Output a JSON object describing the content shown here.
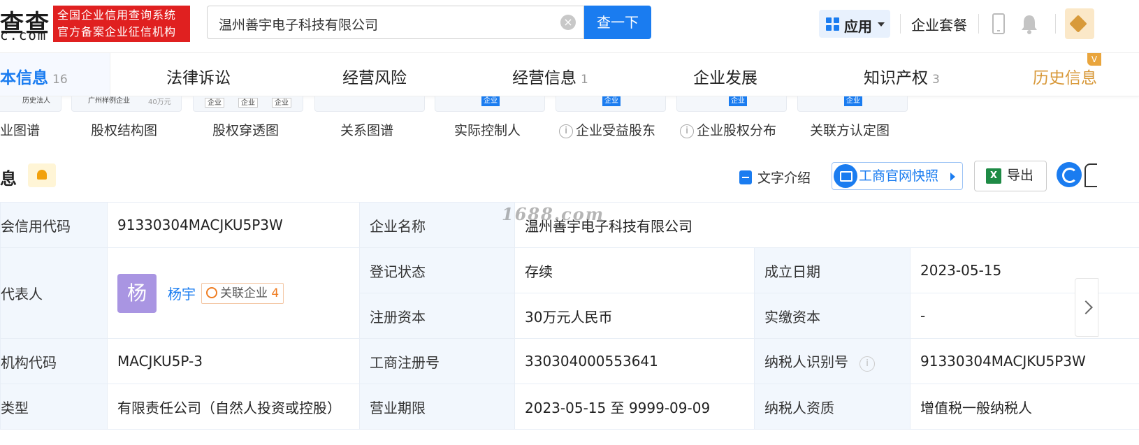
{
  "header": {
    "logo_text": "查查",
    "logo_sub": "c.com",
    "slogan_line1": "全国企业信用查询系统",
    "slogan_line2": "官方备案企业征信机构",
    "search_value": "温州善宇电子科技有限公司",
    "search_button": "查一下",
    "apps_label": "应用",
    "package_label": "企业套餐",
    "icons": [
      "search-clear-icon",
      "apps-grid-icon",
      "phone-icon",
      "bell-icon",
      "vip-diamond-icon"
    ]
  },
  "nav": {
    "tabs": [
      {
        "label": "本信息",
        "count": "16"
      },
      {
        "label": "法律诉讼",
        "count": ""
      },
      {
        "label": "经营风险",
        "count": ""
      },
      {
        "label": "经营信息",
        "count": "1"
      },
      {
        "label": "企业发展",
        "count": ""
      },
      {
        "label": "知识产权",
        "count": "3"
      },
      {
        "label": "历史信息",
        "count": ""
      }
    ],
    "history_badge": "V",
    "active_color": "#1a7cf0",
    "history_color": "#d8993a"
  },
  "thumbs": {
    "labels": [
      "业图谱",
      "股权结构图",
      "股权穿透图",
      "关系图谱",
      "实际控制人",
      "企业受益股东",
      "企业股权分布",
      "关联方认定图"
    ],
    "mini": {
      "history_legal": "历史法人",
      "gz_company": "广州样例企业",
      "amount": "40万元",
      "company": "企业"
    }
  },
  "section": {
    "title": "息",
    "text_intro": "文字介绍",
    "snapshot": "工商官网快照",
    "export": "导出",
    "export_icon_letter": "X"
  },
  "watermark": "1688.com",
  "table": {
    "credit_code_label": "会信用代码",
    "credit_code": "91330304MACJKU5P3W",
    "company_name_label": "企业名称",
    "company_name": "温州善宇电子科技有限公司",
    "legal_rep_label": "代表人",
    "avatar_char": "杨",
    "legal_rep_name": "杨宇",
    "related_label": "关联企业",
    "related_count": "4",
    "reg_status_label": "登记状态",
    "reg_status": "存续",
    "found_date_label": "成立日期",
    "found_date": "2023-05-15",
    "reg_capital_label": "注册资本",
    "reg_capital": "30万元人民币",
    "paid_capital_label": "实缴资本",
    "paid_capital": "-",
    "org_code_label": "机构代码",
    "org_code": "MACJKU5P-3",
    "biz_reg_no_label": "工商注册号",
    "biz_reg_no": "330304000553641",
    "taxpayer_id_label": "纳税人识别号",
    "taxpayer_id": "91330304MACJKU5P3W",
    "type_label": "类型",
    "type": "有限责任公司（自然人投资或控股）",
    "biz_term_label": "营业期限",
    "biz_term": "2023-05-15 至 9999-09-09",
    "taxpayer_qual_label": "纳税人资质",
    "taxpayer_qual": "增值税一般纳税人"
  }
}
